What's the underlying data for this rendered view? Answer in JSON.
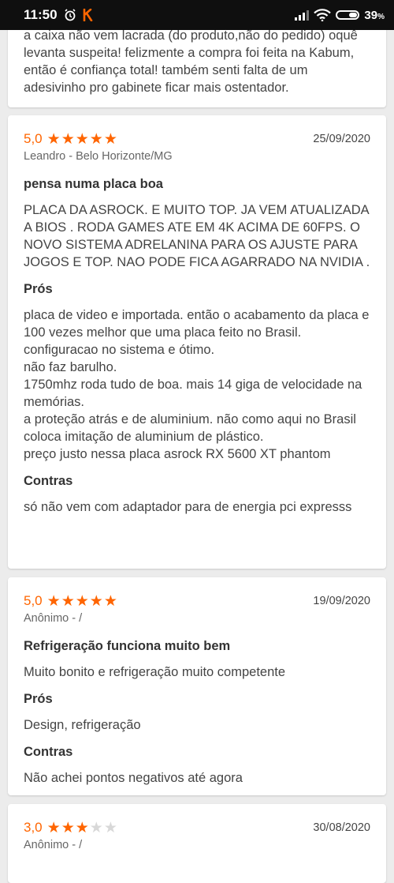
{
  "status_bar": {
    "time": "11:50",
    "battery": "39",
    "battery_suffix": "%",
    "battery_level": 0.39
  },
  "accent_color": "#ff6500",
  "reviews": [
    {
      "partial": true,
      "body": "a caixa não vem lacrada (do produto,não do pedido) oquê levanta suspeita! felizmente a compra foi feita na Kabum, então é confiança total! também senti falta de um adesivinho pro gabinete ficar mais ostentador."
    },
    {
      "rating": "5,0",
      "stars": 5,
      "date": "25/09/2020",
      "author": "Leandro - Belo Horizonte/MG",
      "title": "pensa numa placa boa",
      "body": "PLACA DA ASROCK. E MUITO TOP. JA VEM ATUALIZADA A BIOS . RODA GAMES ATE EM 4K ACIMA DE 60FPS. O NOVO SISTEMA ADRELANINA PARA OS AJUSTE PARA JOGOS E TOP. NAO PODE FICA AGARRADO NA NVIDIA .",
      "pros_label": "Prós",
      "pros": "placa de video e importada. então o acabamento da placa e 100 vezes melhor que uma placa feito no Brasil.\n configuracao no sistema e ótimo.\nnão faz barulho.\n1750mhz roda tudo de boa. mais 14 giga de velocidade na memórias.\na proteção atrás e de aluminium. não como aqui no Brasil coloca imitação de aluminium de plástico.\npreço justo nessa placa asrock RX 5600 XT phantom",
      "cons_label": "Contras",
      "cons": "só não vem com adaptador para de energia pci expresss"
    },
    {
      "rating": "5,0",
      "stars": 5,
      "date": "19/09/2020",
      "author": "Anônimo - /",
      "title": "Refrigeração funciona muito bem",
      "body": "Muito bonito e refrigeração muito competente",
      "pros_label": "Prós",
      "pros": "Design, refrigeração",
      "cons_label": "Contras",
      "cons": "Não achei pontos negativos até agora"
    },
    {
      "rating": "3,0",
      "stars": 3,
      "date": "30/08/2020",
      "author": "Anônimo - /"
    }
  ]
}
